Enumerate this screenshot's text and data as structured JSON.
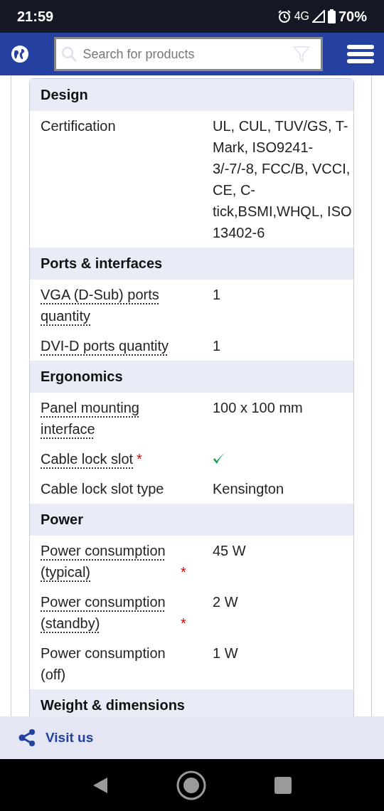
{
  "status_bar": {
    "time": "21:59",
    "network": "4G",
    "battery": "70%"
  },
  "header": {
    "search": {
      "placeholder": "Search for products"
    }
  },
  "sections": [
    {
      "title": "Design",
      "rows": [
        {
          "label": "Certification",
          "underlined": false,
          "kind": "text",
          "value": "UL, CUL, TUV/GS, T-Mark, ISO9241-3/-7/-8, FCC/B, VCCI, CE, C-tick,BSMI,WHQL, ISO 13402-6"
        }
      ]
    },
    {
      "title": "Ports & interfaces",
      "rows": [
        {
          "label": "VGA (D-Sub) ports quantity",
          "underlined": true,
          "kind": "text",
          "value": "1"
        },
        {
          "label": "DVI-D ports quantity",
          "underlined": true,
          "kind": "text",
          "value": "1"
        }
      ]
    },
    {
      "title": "Ergonomics",
      "rows": [
        {
          "label": "Panel mounting interface",
          "underlined": true,
          "kind": "text",
          "value": "100 x 100 mm"
        },
        {
          "label": "Cable lock slot",
          "underlined": true,
          "required_mark": "*",
          "kind": "check",
          "checked": true
        },
        {
          "label": "Cable lock slot type",
          "underlined": false,
          "kind": "text",
          "value": "Kensington"
        }
      ]
    },
    {
      "title": "Power",
      "rows": [
        {
          "label": "Power consumption (typical)",
          "underlined": true,
          "required_mark": "*",
          "kind": "text",
          "value": "45 W"
        },
        {
          "label": "Power consumption (standby)",
          "underlined": true,
          "required_mark": "*",
          "kind": "text",
          "value": "2 W"
        },
        {
          "label": "Power consumption (off)",
          "underlined": false,
          "kind": "text",
          "value": "1 W"
        }
      ]
    },
    {
      "title": "Weight & dimensions"
    }
  ],
  "footer": {
    "link": "Visit us"
  }
}
